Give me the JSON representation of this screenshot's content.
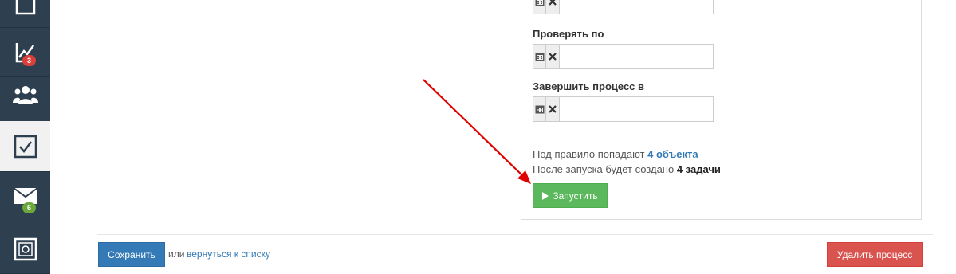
{
  "sidebar": {
    "items": [
      {
        "icon": "document-icon"
      },
      {
        "icon": "chart-icon",
        "badge": "3",
        "badge_color": "#d9403a"
      },
      {
        "icon": "users-icon"
      },
      {
        "icon": "checkbox-icon",
        "active": true
      },
      {
        "icon": "envelope-icon",
        "badge": "6",
        "badge_color": "#6aa83b"
      },
      {
        "icon": "safe-icon"
      }
    ]
  },
  "form": {
    "check_by_label": "Проверять по",
    "finish_label": "Завершить процесс в",
    "calendar_icon": "calendar-icon",
    "clear_icon": "clear-icon",
    "first_date_value": "",
    "check_by_value": "",
    "finish_value": ""
  },
  "summary": {
    "objects_prefix": "Под правило попадают",
    "objects_count": "4 объекта",
    "tasks_prefix": "После запуска будет создано",
    "tasks_count": "4 задачи"
  },
  "run_button": {
    "label": "Запустить",
    "color": "#5cb85c"
  },
  "footer": {
    "save_label": "Сохранить",
    "or_text": "или",
    "back_link": "вернуться к списку",
    "delete_label": "Удалить процесс",
    "save_color": "#337ab7",
    "delete_color": "#d9534f"
  },
  "annotation": {
    "arrow_color": "#e00000"
  }
}
